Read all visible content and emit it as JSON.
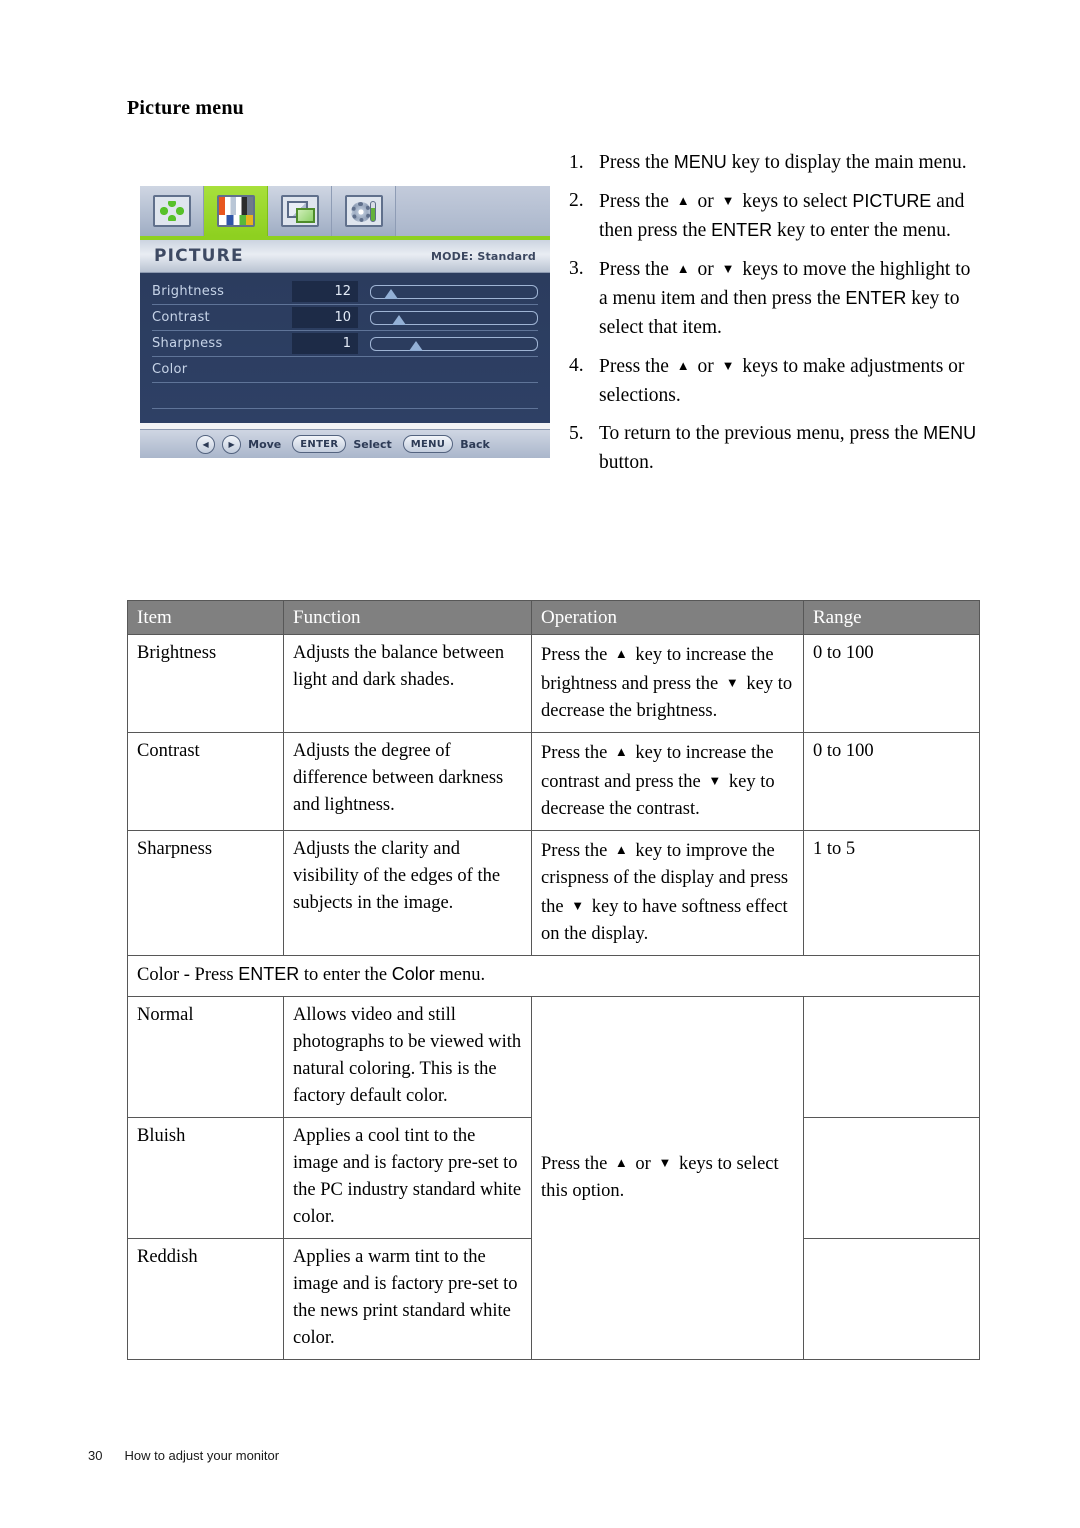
{
  "page_title": "Picture menu",
  "osd": {
    "tabs": [
      {
        "icon": "position-move-icon",
        "label": "Display",
        "active": false
      },
      {
        "icon": "picture-color-bars-icon",
        "label": "Picture",
        "active": true
      },
      {
        "icon": "display-overlap-icon",
        "label": "Picture Advanced",
        "active": false
      },
      {
        "icon": "system-gear-tool-icon",
        "label": "System",
        "active": false
      }
    ],
    "title": "PICTURE",
    "mode": "MODE: Standard",
    "rows": [
      {
        "label": "Brightness",
        "value": "12",
        "slider": true,
        "percent": 12
      },
      {
        "label": "Contrast",
        "value": "10",
        "slider": true,
        "percent": 17
      },
      {
        "label": "Sharpness",
        "value": "1",
        "slider": true,
        "percent": 27
      },
      {
        "label": "Color",
        "value": "",
        "slider": false,
        "percent": 0
      }
    ],
    "footer": {
      "move_label": "Move",
      "enter_key": "ENTER",
      "select_label": "Select",
      "menu_key": "MENU",
      "back_label": "Back",
      "left_arrow": "◀",
      "right_arrow": "▶"
    }
  },
  "steps": [
    {
      "num": "1.",
      "parts": [
        {
          "t": "Press the ",
          "k": false
        },
        {
          "t": "MENU",
          "k": true
        },
        {
          "t": " key to display the main menu.",
          "k": false
        }
      ]
    },
    {
      "num": "2.",
      "parts": [
        {
          "t": "Press the ",
          "k": false
        },
        {
          "t": "▲",
          "k": false,
          "arrow": true
        },
        {
          "t": " or ",
          "k": false
        },
        {
          "t": "▼",
          "k": false,
          "arrow": true
        },
        {
          "t": " keys to select ",
          "k": false
        },
        {
          "t": "PICTURE",
          "k": true
        },
        {
          "t": " and then press the ",
          "k": false
        },
        {
          "t": "ENTER",
          "k": true
        },
        {
          "t": " key to enter the menu.",
          "k": false
        }
      ]
    },
    {
      "num": "3.",
      "parts": [
        {
          "t": "Press the ",
          "k": false
        },
        {
          "t": "▲",
          "k": false,
          "arrow": true
        },
        {
          "t": " or ",
          "k": false
        },
        {
          "t": "▼",
          "k": false,
          "arrow": true
        },
        {
          "t": " keys to move the highlight to a menu item and then press the ",
          "k": false
        },
        {
          "t": "ENTER",
          "k": true
        },
        {
          "t": " key to select that item.",
          "k": false
        }
      ]
    },
    {
      "num": "4.",
      "parts": [
        {
          "t": "Press the ",
          "k": false
        },
        {
          "t": "▲",
          "k": false,
          "arrow": true
        },
        {
          "t": " or ",
          "k": false
        },
        {
          "t": "▼",
          "k": false,
          "arrow": true
        },
        {
          "t": " keys to make adjustments or selections.",
          "k": false
        }
      ]
    },
    {
      "num": "5.",
      "parts": [
        {
          "t": "To return to the previous menu, press the ",
          "k": false
        },
        {
          "t": "MENU",
          "k": true
        },
        {
          "t": " button.",
          "k": false
        }
      ]
    }
  ],
  "table": {
    "headers": [
      "Item",
      "Function",
      "Operation",
      "Range"
    ],
    "rows": [
      {
        "item": "Brightness",
        "function": "Adjusts the balance between light and dark shades.",
        "operation_parts": [
          {
            "t": "Press the ",
            "arrow": false
          },
          {
            "t": "▲",
            "arrow": true
          },
          {
            "t": " key to increase the brightness and press the ",
            "arrow": false
          },
          {
            "t": "▼",
            "arrow": true
          },
          {
            "t": " key to decrease the brightness.",
            "arrow": false
          }
        ],
        "range": "0 to 100"
      },
      {
        "item": "Contrast",
        "function": "Adjusts the degree of difference between darkness and lightness.",
        "operation_parts": [
          {
            "t": "Press the ",
            "arrow": false
          },
          {
            "t": "▲",
            "arrow": true
          },
          {
            "t": " key to increase the contrast and press the ",
            "arrow": false
          },
          {
            "t": "▼",
            "arrow": true
          },
          {
            "t": " key to decrease the contrast.",
            "arrow": false
          }
        ],
        "range": "0 to 100"
      },
      {
        "item": "Sharpness",
        "function": "Adjusts the clarity and visibility of the edges of the subjects in the image.",
        "operation_parts": [
          {
            "t": "Press the ",
            "arrow": false
          },
          {
            "t": "▲",
            "arrow": true
          },
          {
            "t": " key to improve the crispness of the display and press the ",
            "arrow": false
          },
          {
            "t": "▼",
            "arrow": true
          },
          {
            "t": " key to have softness effect on the display.",
            "arrow": false
          }
        ],
        "range": "1 to 5"
      }
    ],
    "color_section_parts": [
      {
        "t": "Color - Press ",
        "k": false
      },
      {
        "t": "ENTER",
        "k": true
      },
      {
        "t": " to enter the ",
        "k": false
      },
      {
        "t": "Color",
        "k": true
      },
      {
        "t": " menu.",
        "k": false
      }
    ],
    "color_rows": [
      {
        "item": "Normal",
        "function": "Allows video and still photographs to be viewed with natural coloring. This is the factory default color.",
        "range": ""
      },
      {
        "item": "Bluish",
        "function": "Applies a cool tint to the image and is factory pre-set to the PC industry standard white color.",
        "range": ""
      },
      {
        "item": "Reddish",
        "function": "Applies a warm tint to the image and is factory pre-set to the news print standard white color.",
        "range": ""
      }
    ],
    "color_operation_parts": [
      {
        "t": "Press the ",
        "arrow": false
      },
      {
        "t": "▲",
        "arrow": true
      },
      {
        "t": " or ",
        "arrow": false
      },
      {
        "t": "▼",
        "arrow": true
      },
      {
        "t": " keys to select this option.",
        "arrow": false
      }
    ]
  },
  "footer": {
    "page_number": "30",
    "chapter": "How to adjust your monitor"
  }
}
